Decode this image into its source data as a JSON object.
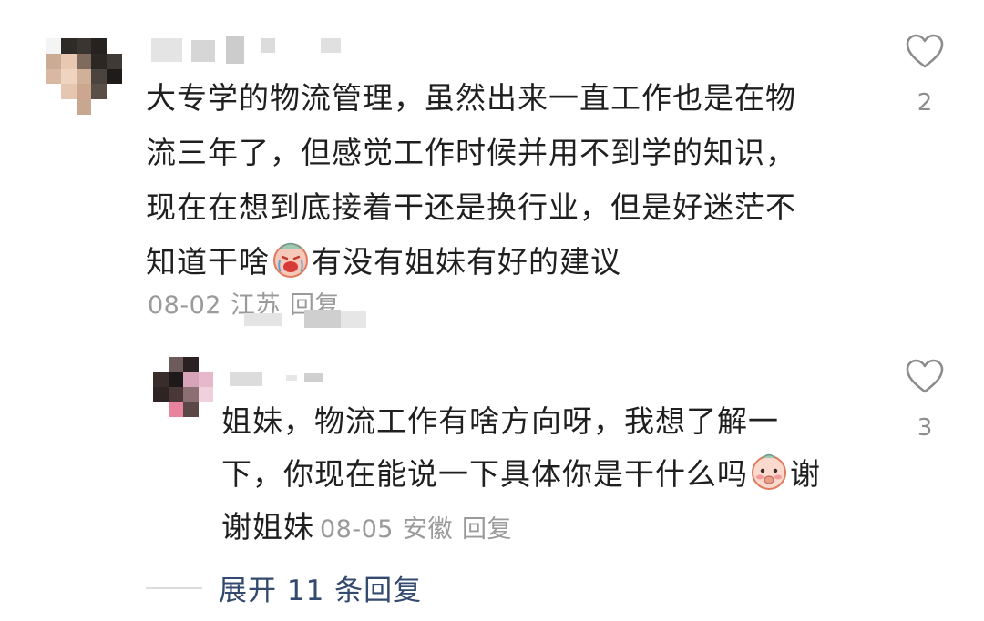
{
  "comment": {
    "text_lines": [
      "大专学的物流管理，虽然出来一直工作也是在物",
      "流三年了，但感觉工作时候并用不到学的知识，",
      "现在在想到底接着干还是换行业，但是好迷茫不",
      "知道干啥"
    ],
    "text_after_emoji": "有没有姐妹有好的建议",
    "emoji_icon": "crying-face-emoji",
    "date": "08-02",
    "location": "江苏",
    "reply_label": "回复",
    "like_count": "2"
  },
  "reply": {
    "text_lines": [
      "姐妹，物流工作有啥方向呀，我想了解一",
      "下，你现在能说一下具体你是干什么吗"
    ],
    "text_after_emoji": "谢",
    "last_line_text": "谢姐妹",
    "emoji_icon": "shy-face-emoji",
    "date": "08-05",
    "location": "安徽",
    "reply_label": "回复",
    "like_count": "3"
  },
  "expand_replies_label": "展开 11 条回复",
  "colors": {
    "text": "#1f1f1f",
    "meta": "#9a9a9a",
    "link": "#33496e",
    "icon": "#8c8c8c"
  }
}
